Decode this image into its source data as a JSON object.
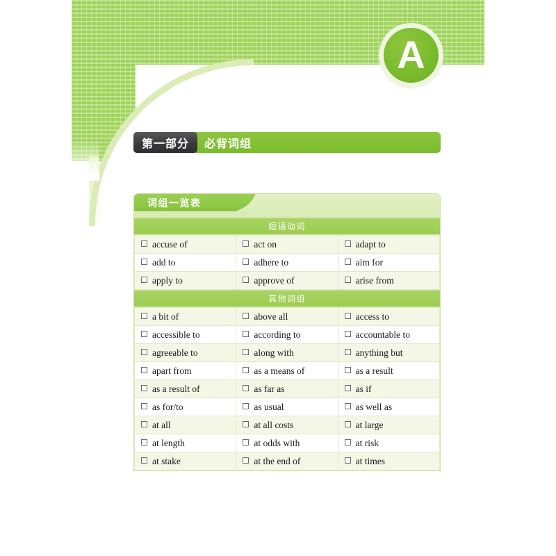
{
  "page": {
    "badge_letter": "A",
    "accent_green": "#8cc63f",
    "banner_green": "#9fd45a",
    "tab_dark": "#3a3a3c",
    "row_tint": "#f4f6e6",
    "border_green": "#cfe0a5"
  },
  "title_bar": {
    "part_label": "第一部分",
    "section_label": "必背词组"
  },
  "card": {
    "tab_label": "词组一览表",
    "sections": [
      {
        "heading": "短语动词",
        "rows": [
          [
            "accuse of",
            "act on",
            "adapt to"
          ],
          [
            "add to",
            "adhere to",
            "aim for"
          ],
          [
            "apply to",
            "approve of",
            "arise from"
          ]
        ]
      },
      {
        "heading": "其他词组",
        "rows": [
          [
            "a bit of",
            "above all",
            "access to"
          ],
          [
            "accessible to",
            "according to",
            "accountable to"
          ],
          [
            "agreeable to",
            "along with",
            "anything but"
          ],
          [
            "apart from",
            "as a means of",
            "as a result"
          ],
          [
            "as a result of",
            "as far as",
            "as if"
          ],
          [
            "as for/to",
            "as usual",
            "as well as"
          ],
          [
            "at all",
            "at all costs",
            "at large"
          ],
          [
            "at length",
            "at odds with",
            "at risk"
          ],
          [
            "at stake",
            "at the end of",
            "at times"
          ]
        ]
      }
    ]
  }
}
